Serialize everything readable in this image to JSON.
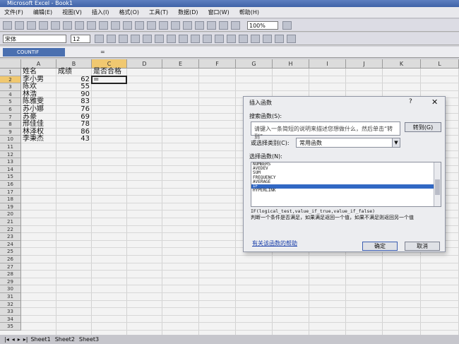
{
  "window": {
    "title": "Microsoft Excel - Book1"
  },
  "menu": [
    "文件(F)",
    "编辑(E)",
    "视图(V)",
    "插入(I)",
    "格式(O)",
    "工具(T)",
    "数据(D)",
    "窗口(W)",
    "帮助(H)"
  ],
  "toolbar": {
    "zoom": "100%",
    "font": "宋体",
    "font_size": "12"
  },
  "formula_bar": {
    "name_box": "COUNTIF",
    "fx": "="
  },
  "columns": [
    "A",
    "B",
    "C",
    "D",
    "E",
    "F",
    "G",
    "H",
    "I",
    "J",
    "K",
    "L"
  ],
  "rows": [
    "1",
    "2",
    "3",
    "4",
    "5",
    "6",
    "7",
    "8",
    "9",
    "10",
    "11",
    "12",
    "13",
    "14",
    "15",
    "16",
    "17",
    "18",
    "19",
    "20",
    "21",
    "22",
    "23",
    "24",
    "25",
    "26",
    "27",
    "28",
    "29",
    "30",
    "31",
    "32",
    "33",
    "34",
    "35"
  ],
  "cells": {
    "A1": "姓名",
    "B1": "成绩",
    "C1": "是否合格",
    "C2": "=",
    "names": [
      "李小男",
      "陈欢",
      "林浩",
      "陈雅雯",
      "苏小娜",
      "苏豪",
      "邢佳佳",
      "林泽权",
      "李秉杰"
    ],
    "scores": [
      "62",
      "55",
      "90",
      "83",
      "76",
      "69",
      "78",
      "86",
      "43"
    ]
  },
  "sheet_tabs": [
    "Sheet1",
    "Sheet2",
    "Sheet3"
  ],
  "dialog": {
    "title": "插入函数",
    "help": "?",
    "close": "✕",
    "search_label": "搜索函数(S):",
    "search_placeholder": "请输入一条简短说明来描述您想做什么，然后单击“转到”",
    "search_value": "请键入一条简短的说明来描述您想做什么，然后单击“转到”",
    "goto_label": "转到(G)",
    "category_label": "或选择类别(C):",
    "category_value": "常用函数",
    "list_label": "选择函数(N):",
    "functions": [
      "NUMBERS",
      "AVEDEV",
      "SUM",
      "FREQUENCY",
      "AVERAGE",
      "IF",
      "HYPERLINK"
    ],
    "selected_function": "IF",
    "syntax": "IF(logical_test,value_if_true,value_if_false)",
    "description": "判断一个条件是否满足，如果满足返回一个值，如果不满足则返回另一个值",
    "help_link": "有关该函数的帮助",
    "ok": "确定",
    "cancel": "取消"
  }
}
